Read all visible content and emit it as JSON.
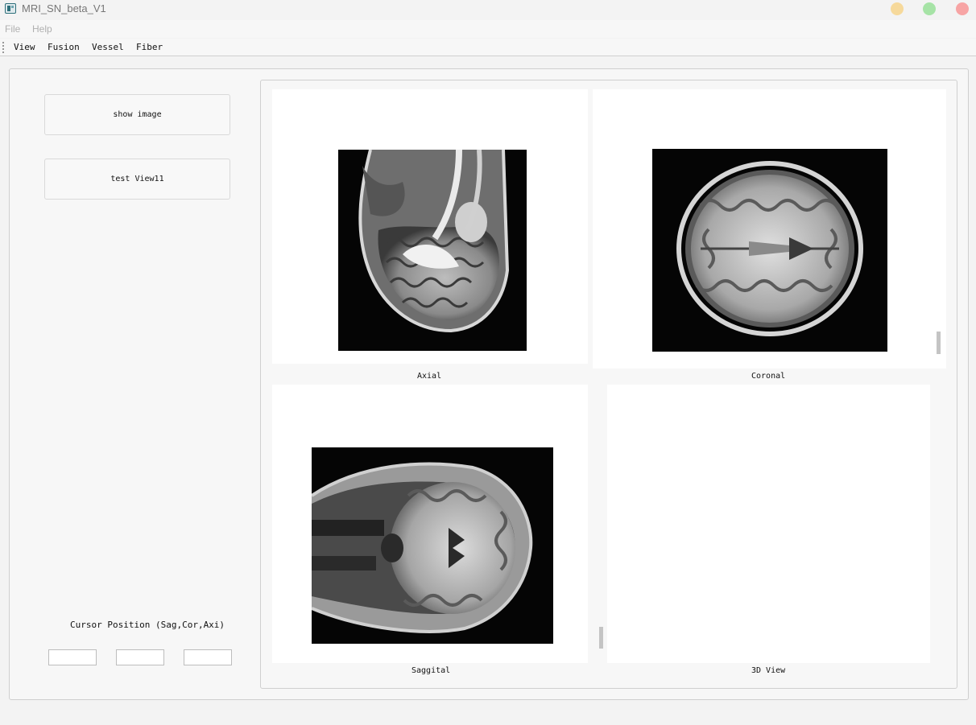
{
  "window": {
    "title": "MRI_SN_beta_V1"
  },
  "menubar": {
    "items": [
      "File",
      "Help"
    ]
  },
  "toolbar": {
    "items": [
      "View",
      "Fusion",
      "Vessel",
      "Fiber"
    ]
  },
  "left_panel": {
    "show_image_button": "show image",
    "test_view_button": "test View11",
    "cursor_label": "Cursor Position (Sag,Cor,Axi)",
    "fields": [
      "",
      "",
      ""
    ]
  },
  "views": {
    "axial": {
      "label": "Axial"
    },
    "coronal": {
      "label": "Coronal"
    },
    "saggital": {
      "label": "Saggital"
    },
    "view3d": {
      "label": "3D View"
    }
  }
}
